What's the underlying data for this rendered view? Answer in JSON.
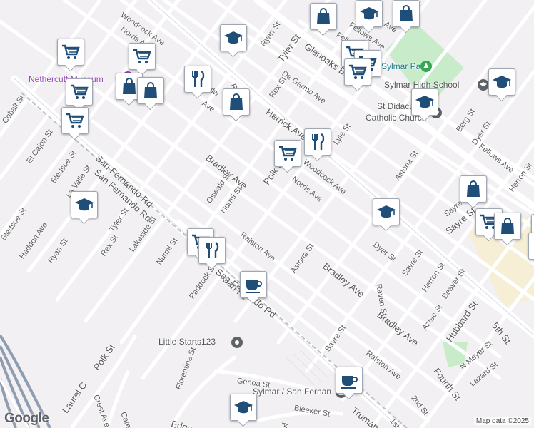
{
  "map": {
    "logo_text": "Google",
    "attribution": "Map data ©2025",
    "colors": {
      "land": "#f2f0f3",
      "road": "#ffffff",
      "park": "#c8ebc9",
      "freeway": "#8f9db0",
      "pin_icon": "#1f4e79",
      "poi_purple": "#9c3fb6",
      "poi_teal": "#1d7b85"
    }
  },
  "streets": [
    {
      "id": "woodcock-ave-top",
      "text": "Woodcock Ave"
    },
    {
      "id": "norris-ave-top",
      "text": "Norris Ave"
    },
    {
      "id": "ryan-st-top",
      "text": "Ryan St"
    },
    {
      "id": "tyler-st-top",
      "text": "Tyler St"
    },
    {
      "id": "glenoaks-blvd",
      "text": "Glenoaks Blvd"
    },
    {
      "id": "fellows-ave-top",
      "text": "Fellows Ave"
    },
    {
      "id": "de-garmo-ave",
      "text": "De Garmo Ave"
    },
    {
      "id": "rex-st-top",
      "text": "Rex St"
    },
    {
      "id": "herrick-ave",
      "text": "Herrick Ave"
    },
    {
      "id": "lyle-st",
      "text": "Lyle St"
    },
    {
      "id": "san-fernando-rd-upper",
      "text": "San Fernando Rd"
    },
    {
      "id": "san-fernando-rd-lower",
      "text": "San Fernando Rd"
    },
    {
      "id": "cobalt-st",
      "text": "Cobalt St"
    },
    {
      "id": "el-cajon-st",
      "text": "El Cajon St"
    },
    {
      "id": "bledsoe-st-upper",
      "text": "Bledsoe St"
    },
    {
      "id": "la-valle-st",
      "text": "La Valle St"
    },
    {
      "id": "bradley-ave-upper",
      "text": "Bradley Ave"
    },
    {
      "id": "oswald-st",
      "text": "Oswald St"
    },
    {
      "id": "nurmi-st-upper",
      "text": "Nurmi St"
    },
    {
      "id": "polk-st-upper",
      "text": "Polk St"
    },
    {
      "id": "norris-ave-mid",
      "text": "Norris Ave"
    },
    {
      "id": "woodcock-ave-mid",
      "text": "Woodcock Ave"
    },
    {
      "id": "astoria-st-upper",
      "text": "Astoria St"
    },
    {
      "id": "berg-st",
      "text": "Berg St"
    },
    {
      "id": "dyer-st-upper",
      "text": "Dyer St"
    },
    {
      "id": "fellows-ave-mid",
      "text": "Fellows Ave"
    },
    {
      "id": "herron-st-upper",
      "text": "Herron St"
    },
    {
      "id": "sayre-st-upper",
      "text": "Sayre St"
    },
    {
      "id": "dyer-st-mid",
      "text": "Dyer St"
    },
    {
      "id": "bledsoe-st-lower",
      "text": "Bledsoe St"
    },
    {
      "id": "haddon-ave",
      "text": "Haddon Ave"
    },
    {
      "id": "ryan-st-lower",
      "text": "Ryan St"
    },
    {
      "id": "rex-st-lower",
      "text": "Rex St"
    },
    {
      "id": "tyler-st-lower",
      "text": "Tyler St"
    },
    {
      "id": "lakeside-st",
      "text": "Lakeside St"
    },
    {
      "id": "nurmi-st-lower",
      "text": "Nurmi St"
    },
    {
      "id": "ralston-ave-upper",
      "text": "Ralston Ave"
    },
    {
      "id": "astoria-st-lower",
      "text": "Astoria St"
    },
    {
      "id": "bradley-ave-mid",
      "text": "Bradley Ave"
    },
    {
      "id": "raven-st",
      "text": "Raven St"
    },
    {
      "id": "sayre-st-mid",
      "text": "Sayre St"
    },
    {
      "id": "herron-st-lower",
      "text": "Herron St"
    },
    {
      "id": "beaver-st",
      "text": "Beaver St"
    },
    {
      "id": "paddock-st",
      "text": "Paddock St"
    },
    {
      "id": "san-fernando-rd-mid",
      "text": "San Fernando Rd"
    },
    {
      "id": "bradley-ave-lower",
      "text": "Bradley Ave"
    },
    {
      "id": "aztec-st",
      "text": "Aztec St"
    },
    {
      "id": "hubbard-st",
      "text": "Hubbard St"
    },
    {
      "id": "fifth-st",
      "text": "5th St"
    },
    {
      "id": "fourth-st",
      "text": "Fourth St"
    },
    {
      "id": "n-meyer-st",
      "text": "N Meyer St"
    },
    {
      "id": "lazard-st",
      "text": "Lazard St"
    },
    {
      "id": "sayre-st-lower",
      "text": "Sayre St"
    },
    {
      "id": "ralston-ave-lower",
      "text": "Ralston Ave"
    },
    {
      "id": "polk-st-lower",
      "text": "Polk St"
    },
    {
      "id": "florentine-st",
      "text": "Florentine St"
    },
    {
      "id": "genoa-st",
      "text": "Genoa St"
    },
    {
      "id": "crest-ave",
      "text": "Crest Ave"
    },
    {
      "id": "laurel-c",
      "text": "Laurel C"
    },
    {
      "id": "carey-r",
      "text": "Carey R"
    },
    {
      "id": "edgo",
      "text": "Edgo"
    },
    {
      "id": "bleeker-st",
      "text": "Bleeker St"
    },
    {
      "id": "truman",
      "text": "Truman"
    },
    {
      "id": "second-st",
      "text": "2nd St"
    },
    {
      "id": "first-st",
      "text": "1st St"
    },
    {
      "id": "ave-bottom",
      "text": "Ave"
    },
    {
      "id": "san-fe-stub",
      "text": "San Fe"
    },
    {
      "id": "rodi-stub",
      "text": "R"
    },
    {
      "id": "ave-stub",
      "text": "Ave"
    },
    {
      "id": "sayre-stub",
      "text": "Sayre St"
    },
    {
      "id": "hn-ave-stub",
      "text": "n Ave"
    },
    {
      "id": "fellows-stub",
      "text": "Fellows A"
    },
    {
      "id": "elk-stub",
      "text": "ellw"
    }
  ],
  "places": [
    {
      "id": "nethercutt-museum",
      "text": "Nethercutt Museum",
      "kind": "purple"
    },
    {
      "id": "sylmar-park",
      "text": "Sylmar Park",
      "kind": "teal"
    },
    {
      "id": "sylmar-high-school",
      "text": "Sylmar High School",
      "kind": "grey"
    },
    {
      "id": "st-didacus",
      "text": "St Didacus",
      "kind": "grey"
    },
    {
      "id": "catholic-church",
      "text": "Catholic Church",
      "kind": "grey"
    },
    {
      "id": "little-starts",
      "text": "Little Starts123",
      "kind": "grey"
    },
    {
      "id": "sylmar-station",
      "text": "Sylmar / San Fernan",
      "kind": "grey"
    }
  ],
  "markers": [
    {
      "id": "m1",
      "icon": "shopping-bag-icon"
    },
    {
      "id": "m2",
      "icon": "graduation-cap-icon"
    },
    {
      "id": "m3",
      "icon": "shopping-cart-icon"
    },
    {
      "id": "m4",
      "icon": "shopping-cart-icon"
    },
    {
      "id": "m5",
      "icon": "shopping-cart-icon"
    },
    {
      "id": "m6",
      "icon": "shopping-cart-icon"
    },
    {
      "id": "m7",
      "icon": "shopping-bag-icon"
    },
    {
      "id": "m8",
      "icon": "shopping-bag-icon"
    },
    {
      "id": "m9",
      "icon": "restaurant-icon"
    },
    {
      "id": "m10",
      "icon": "shopping-bag-icon"
    },
    {
      "id": "m11",
      "icon": "graduation-cap-icon"
    },
    {
      "id": "m12",
      "icon": "shopping-cart-icon"
    },
    {
      "id": "m13",
      "icon": "shopping-cart-icon"
    },
    {
      "id": "m14",
      "icon": "shopping-cart-icon"
    },
    {
      "id": "m15",
      "icon": "graduation-cap-icon"
    },
    {
      "id": "m16",
      "icon": "graduation-cap-icon"
    },
    {
      "id": "m17",
      "icon": "shopping-cart-icon"
    },
    {
      "id": "m18",
      "icon": "restaurant-icon"
    },
    {
      "id": "m19",
      "icon": "graduation-cap-icon"
    },
    {
      "id": "m20",
      "icon": "shopping-bag-icon"
    },
    {
      "id": "m21",
      "icon": "shopping-cart-icon"
    },
    {
      "id": "m22",
      "icon": "shopping-bag-icon"
    },
    {
      "id": "m23",
      "icon": "graduation-cap-icon"
    },
    {
      "id": "m24",
      "icon": "shopping-cart-icon"
    },
    {
      "id": "m25",
      "icon": "restaurant-icon"
    },
    {
      "id": "m26",
      "icon": "coffee-icon"
    },
    {
      "id": "m27",
      "icon": "coffee-icon"
    },
    {
      "id": "m28",
      "icon": "graduation-cap-icon"
    },
    {
      "id": "m29",
      "icon": "shopping-bag-icon"
    },
    {
      "id": "m30",
      "icon": "shopping-bag-icon"
    },
    {
      "id": "m31",
      "icon": "shopping-bag-icon"
    }
  ]
}
